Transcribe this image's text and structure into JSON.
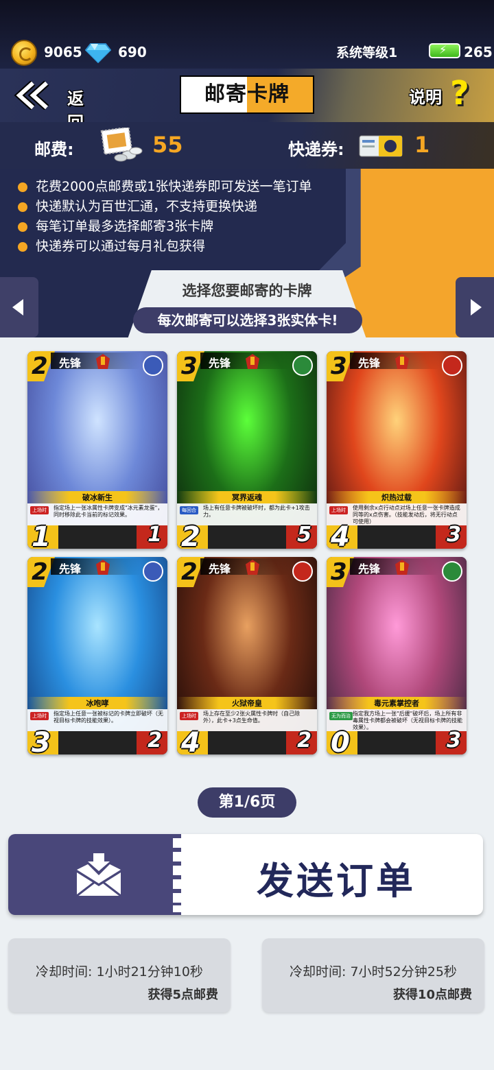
{
  "status": {
    "gold": "9065",
    "diamonds": "690",
    "system_level": "系统等级1",
    "energy": "265"
  },
  "header": {
    "back_label": "返回",
    "title": "邮寄卡牌",
    "help_label": "说明",
    "help_mark": "?"
  },
  "fees": {
    "postage_label": "邮费:",
    "postage_value": "55",
    "express_label": "快递券:",
    "express_value": "1"
  },
  "rules": [
    "花费2000点邮费或1张快递券即可发送一笔订单",
    "快递默认为百世汇通，不支持更换快递",
    "每笔订单最多选择邮寄3张卡牌",
    "快递券可以通过每月礼包获得"
  ],
  "selection": {
    "title": "选择您要邮寄的卡牌",
    "subtitle": "每次邮寄可以选择3张实体卡!"
  },
  "cards": [
    {
      "cost": "2",
      "role": "先锋",
      "name": "破冰新生",
      "tag": "上场时",
      "tag_color": "#cc2222",
      "text": "指定场上一张冰属性卡牌变成\"冰元素龙蛋\"，同时移除此卡当前的标记效果。",
      "attack": "1",
      "hp": "1",
      "art": [
        "#cfe3ff",
        "#6d88d8",
        "#3b3f8f"
      ],
      "attr_color": "#3b5bb8"
    },
    {
      "cost": "3",
      "role": "先锋",
      "name": "冥界返魂",
      "tag": "每回合",
      "tag_color": "#2a5bc4",
      "text": "场上有任意卡牌被破坏时，都为此卡+1攻击力。",
      "attack": "2",
      "hp": "5",
      "art": [
        "#5cff3a",
        "#1c6e18",
        "#0b1f0c"
      ],
      "attr_color": "#2b8a3a"
    },
    {
      "cost": "3",
      "role": "先锋",
      "name": "炽热过载",
      "tag": "上场时",
      "tag_color": "#cc2222",
      "text": "使用剩余x点行动点对场上任意一张卡牌造成同等的x点伤害。（技能发动后，将无行动点可使用）",
      "attack": "4",
      "hp": "3",
      "art": [
        "#ffd27a",
        "#e0461c",
        "#3a0d12"
      ],
      "attr_color": "#c4281c"
    },
    {
      "cost": "2",
      "role": "先锋",
      "name": "冰咆哮",
      "tag": "上场时",
      "tag_color": "#cc2222",
      "text": "指定场上任意一张被标记的卡牌立即破坏（无视目标卡牌的技能效果）。",
      "attack": "3",
      "hp": "2",
      "art": [
        "#a9e4ff",
        "#2a8fe0",
        "#123a78"
      ],
      "attr_color": "#3b5bb8"
    },
    {
      "cost": "2",
      "role": "先锋",
      "name": "火狱帝皇",
      "tag": "上场时",
      "tag_color": "#cc2222",
      "text": "场上存在至少2张火属性卡牌时（自己除外），此卡+3点生命值。",
      "attack": "4",
      "hp": "2",
      "art": [
        "#e8a060",
        "#6a2a16",
        "#160806"
      ],
      "attr_color": "#c4281c"
    },
    {
      "cost": "3",
      "role": "先锋",
      "name": "毒元素掌控者",
      "tag": "无为而治",
      "tag_color": "#2c9a45",
      "text": "指定我方场上一张\"后援\"破坏后，场上所有非毒属性卡牌都会被破坏（无视目标卡牌的技能效果）。",
      "attack": "0",
      "hp": "3",
      "art": [
        "#ff9ad8",
        "#b0487a",
        "#2d2336"
      ],
      "attr_color": "#2b8a3a"
    }
  ],
  "pagination": {
    "label": "第1/6页"
  },
  "send_order": {
    "label": "发送订单"
  },
  "cooldowns": [
    {
      "time": "冷却时间: 1小时21分钟10秒",
      "reward": "获得5点邮费"
    },
    {
      "time": "冷却时间: 7小时52分钟25秒",
      "reward": "获得10点邮费"
    }
  ],
  "colors": {
    "accent_orange": "#f5a623",
    "navy": "#232a4f",
    "button_purple": "#49477a",
    "page_bg": "#ecf0f3"
  }
}
